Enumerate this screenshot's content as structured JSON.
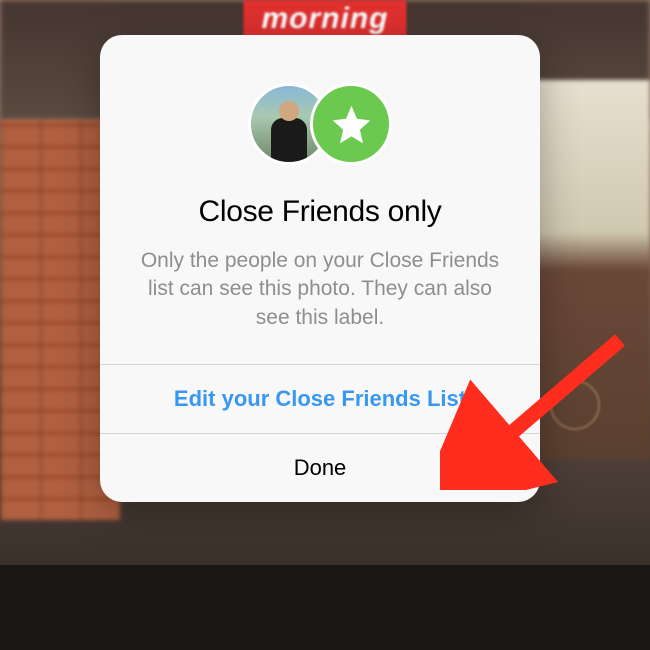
{
  "background": {
    "label_text": "morning"
  },
  "modal": {
    "star_icon_name": "star-icon",
    "title": "Close Friends only",
    "description": "Only the people on your Close Friends list can see this photo. They can also see this label.",
    "primary_button": "Edit your Close Friends List",
    "secondary_button": "Done"
  },
  "colors": {
    "close_friends_green": "#6cc950",
    "link_blue": "#3897f0",
    "arrow_red": "#ff2d1e"
  }
}
